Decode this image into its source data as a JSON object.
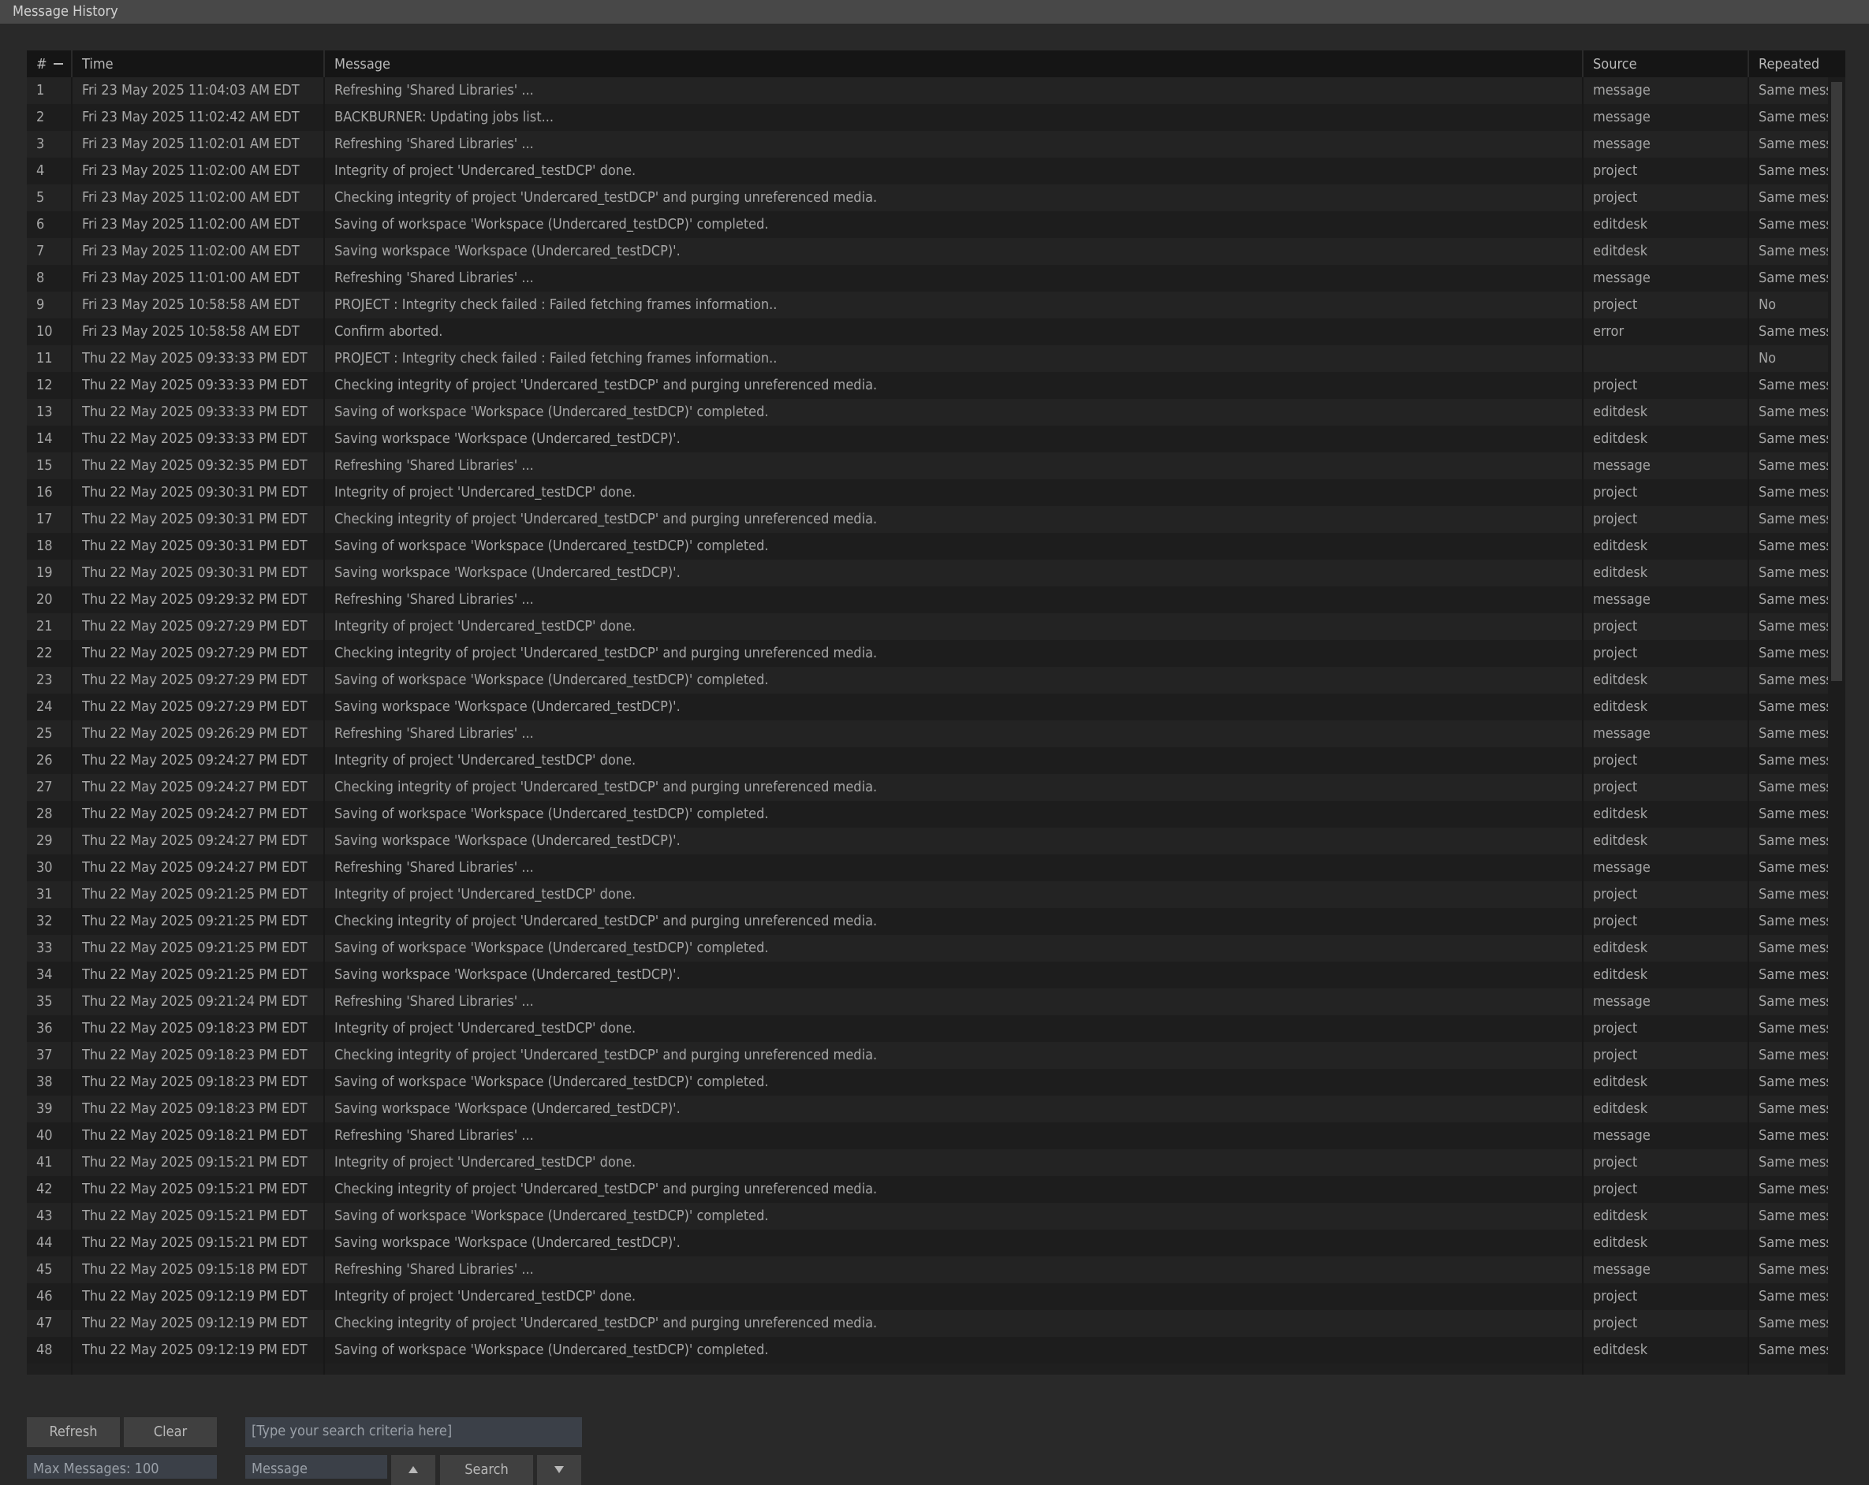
{
  "window": {
    "title": "Message History"
  },
  "table": {
    "columns": {
      "num": "#",
      "time": "Time",
      "message": "Message",
      "source": "Source",
      "repeated": "Repeated"
    },
    "rows": [
      {
        "num": "1",
        "time": "Fri 23 May 2025 11:04:03 AM EDT",
        "message": "Refreshing 'Shared Libraries' ...",
        "source": "message",
        "repeated": "Same mess"
      },
      {
        "num": "2",
        "time": "Fri 23 May 2025 11:02:42 AM EDT",
        "message": "BACKBURNER: Updating jobs list...",
        "source": "message",
        "repeated": "Same mess"
      },
      {
        "num": "3",
        "time": "Fri 23 May 2025 11:02:01 AM EDT",
        "message": "Refreshing 'Shared Libraries' ...",
        "source": "message",
        "repeated": "Same mess"
      },
      {
        "num": "4",
        "time": "Fri 23 May 2025 11:02:00 AM EDT",
        "message": "Integrity of project 'Undercared_testDCP' done.",
        "source": "project",
        "repeated": "Same mess"
      },
      {
        "num": "5",
        "time": "Fri 23 May 2025 11:02:00 AM EDT",
        "message": "Checking integrity of project 'Undercared_testDCP' and purging unreferenced media.",
        "source": "project",
        "repeated": "Same mess"
      },
      {
        "num": "6",
        "time": "Fri 23 May 2025 11:02:00 AM EDT",
        "message": "Saving of workspace 'Workspace (Undercared_testDCP)' completed.",
        "source": "editdesk",
        "repeated": "Same mess"
      },
      {
        "num": "7",
        "time": "Fri 23 May 2025 11:02:00 AM EDT",
        "message": "Saving workspace 'Workspace (Undercared_testDCP)'.",
        "source": "editdesk",
        "repeated": "Same mess"
      },
      {
        "num": "8",
        "time": "Fri 23 May 2025 11:01:00 AM EDT",
        "message": "Refreshing 'Shared Libraries' ...",
        "source": "message",
        "repeated": "Same mess"
      },
      {
        "num": "9",
        "time": "Fri 23 May 2025 10:58:58 AM EDT",
        "message": "PROJECT : Integrity check failed : Failed fetching frames information..",
        "source": "project",
        "repeated": "No"
      },
      {
        "num": "10",
        "time": "Fri 23 May 2025 10:58:58 AM EDT",
        "message": "Confirm aborted.",
        "source": "error",
        "repeated": "Same mess"
      },
      {
        "num": "11",
        "time": "Thu 22 May 2025 09:33:33 PM EDT",
        "message": "PROJECT : Integrity check failed : Failed fetching frames information..",
        "source": "",
        "repeated": "No"
      },
      {
        "num": "12",
        "time": "Thu 22 May 2025 09:33:33 PM EDT",
        "message": "Checking integrity of project 'Undercared_testDCP' and purging unreferenced media.",
        "source": "project",
        "repeated": "Same mess"
      },
      {
        "num": "13",
        "time": "Thu 22 May 2025 09:33:33 PM EDT",
        "message": "Saving of workspace 'Workspace (Undercared_testDCP)' completed.",
        "source": "editdesk",
        "repeated": "Same mess"
      },
      {
        "num": "14",
        "time": "Thu 22 May 2025 09:33:33 PM EDT",
        "message": "Saving workspace 'Workspace (Undercared_testDCP)'.",
        "source": "editdesk",
        "repeated": "Same mess"
      },
      {
        "num": "15",
        "time": "Thu 22 May 2025 09:32:35 PM EDT",
        "message": "Refreshing 'Shared Libraries' ...",
        "source": "message",
        "repeated": "Same mess"
      },
      {
        "num": "16",
        "time": "Thu 22 May 2025 09:30:31 PM EDT",
        "message": "Integrity of project 'Undercared_testDCP' done.",
        "source": "project",
        "repeated": "Same mess"
      },
      {
        "num": "17",
        "time": "Thu 22 May 2025 09:30:31 PM EDT",
        "message": "Checking integrity of project 'Undercared_testDCP' and purging unreferenced media.",
        "source": "project",
        "repeated": "Same mess"
      },
      {
        "num": "18",
        "time": "Thu 22 May 2025 09:30:31 PM EDT",
        "message": "Saving of workspace 'Workspace (Undercared_testDCP)' completed.",
        "source": "editdesk",
        "repeated": "Same mess"
      },
      {
        "num": "19",
        "time": "Thu 22 May 2025 09:30:31 PM EDT",
        "message": "Saving workspace 'Workspace (Undercared_testDCP)'.",
        "source": "editdesk",
        "repeated": "Same mess"
      },
      {
        "num": "20",
        "time": "Thu 22 May 2025 09:29:32 PM EDT",
        "message": "Refreshing 'Shared Libraries' ...",
        "source": "message",
        "repeated": "Same mess"
      },
      {
        "num": "21",
        "time": "Thu 22 May 2025 09:27:29 PM EDT",
        "message": "Integrity of project 'Undercared_testDCP' done.",
        "source": "project",
        "repeated": "Same mess"
      },
      {
        "num": "22",
        "time": "Thu 22 May 2025 09:27:29 PM EDT",
        "message": "Checking integrity of project 'Undercared_testDCP' and purging unreferenced media.",
        "source": "project",
        "repeated": "Same mess"
      },
      {
        "num": "23",
        "time": "Thu 22 May 2025 09:27:29 PM EDT",
        "message": "Saving of workspace 'Workspace (Undercared_testDCP)' completed.",
        "source": "editdesk",
        "repeated": "Same mess"
      },
      {
        "num": "24",
        "time": "Thu 22 May 2025 09:27:29 PM EDT",
        "message": "Saving workspace 'Workspace (Undercared_testDCP)'.",
        "source": "editdesk",
        "repeated": "Same mess"
      },
      {
        "num": "25",
        "time": "Thu 22 May 2025 09:26:29 PM EDT",
        "message": "Refreshing 'Shared Libraries' ...",
        "source": "message",
        "repeated": "Same mess"
      },
      {
        "num": "26",
        "time": "Thu 22 May 2025 09:24:27 PM EDT",
        "message": "Integrity of project 'Undercared_testDCP' done.",
        "source": "project",
        "repeated": "Same mess"
      },
      {
        "num": "27",
        "time": "Thu 22 May 2025 09:24:27 PM EDT",
        "message": "Checking integrity of project 'Undercared_testDCP' and purging unreferenced media.",
        "source": "project",
        "repeated": "Same mess"
      },
      {
        "num": "28",
        "time": "Thu 22 May 2025 09:24:27 PM EDT",
        "message": "Saving of workspace 'Workspace (Undercared_testDCP)' completed.",
        "source": "editdesk",
        "repeated": "Same mess"
      },
      {
        "num": "29",
        "time": "Thu 22 May 2025 09:24:27 PM EDT",
        "message": "Saving workspace 'Workspace (Undercared_testDCP)'.",
        "source": "editdesk",
        "repeated": "Same mess"
      },
      {
        "num": "30",
        "time": "Thu 22 May 2025 09:24:27 PM EDT",
        "message": "Refreshing 'Shared Libraries' ...",
        "source": "message",
        "repeated": "Same mess"
      },
      {
        "num": "31",
        "time": "Thu 22 May 2025 09:21:25 PM EDT",
        "message": "Integrity of project 'Undercared_testDCP' done.",
        "source": "project",
        "repeated": "Same mess"
      },
      {
        "num": "32",
        "time": "Thu 22 May 2025 09:21:25 PM EDT",
        "message": "Checking integrity of project 'Undercared_testDCP' and purging unreferenced media.",
        "source": "project",
        "repeated": "Same mess"
      },
      {
        "num": "33",
        "time": "Thu 22 May 2025 09:21:25 PM EDT",
        "message": "Saving of workspace 'Workspace (Undercared_testDCP)' completed.",
        "source": "editdesk",
        "repeated": "Same mess"
      },
      {
        "num": "34",
        "time": "Thu 22 May 2025 09:21:25 PM EDT",
        "message": "Saving workspace 'Workspace (Undercared_testDCP)'.",
        "source": "editdesk",
        "repeated": "Same mess"
      },
      {
        "num": "35",
        "time": "Thu 22 May 2025 09:21:24 PM EDT",
        "message": "Refreshing 'Shared Libraries' ...",
        "source": "message",
        "repeated": "Same mess"
      },
      {
        "num": "36",
        "time": "Thu 22 May 2025 09:18:23 PM EDT",
        "message": "Integrity of project 'Undercared_testDCP' done.",
        "source": "project",
        "repeated": "Same mess"
      },
      {
        "num": "37",
        "time": "Thu 22 May 2025 09:18:23 PM EDT",
        "message": "Checking integrity of project 'Undercared_testDCP' and purging unreferenced media.",
        "source": "project",
        "repeated": "Same mess"
      },
      {
        "num": "38",
        "time": "Thu 22 May 2025 09:18:23 PM EDT",
        "message": "Saving of workspace 'Workspace (Undercared_testDCP)' completed.",
        "source": "editdesk",
        "repeated": "Same mess"
      },
      {
        "num": "39",
        "time": "Thu 22 May 2025 09:18:23 PM EDT",
        "message": "Saving workspace 'Workspace (Undercared_testDCP)'.",
        "source": "editdesk",
        "repeated": "Same mess"
      },
      {
        "num": "40",
        "time": "Thu 22 May 2025 09:18:21 PM EDT",
        "message": "Refreshing 'Shared Libraries' ...",
        "source": "message",
        "repeated": "Same mess"
      },
      {
        "num": "41",
        "time": "Thu 22 May 2025 09:15:21 PM EDT",
        "message": "Integrity of project 'Undercared_testDCP' done.",
        "source": "project",
        "repeated": "Same mess"
      },
      {
        "num": "42",
        "time": "Thu 22 May 2025 09:15:21 PM EDT",
        "message": "Checking integrity of project 'Undercared_testDCP' and purging unreferenced media.",
        "source": "project",
        "repeated": "Same mess"
      },
      {
        "num": "43",
        "time": "Thu 22 May 2025 09:15:21 PM EDT",
        "message": "Saving of workspace 'Workspace (Undercared_testDCP)' completed.",
        "source": "editdesk",
        "repeated": "Same mess"
      },
      {
        "num": "44",
        "time": "Thu 22 May 2025 09:15:21 PM EDT",
        "message": "Saving workspace 'Workspace (Undercared_testDCP)'.",
        "source": "editdesk",
        "repeated": "Same mess"
      },
      {
        "num": "45",
        "time": "Thu 22 May 2025 09:15:18 PM EDT",
        "message": "Refreshing 'Shared Libraries' ...",
        "source": "message",
        "repeated": "Same mess"
      },
      {
        "num": "46",
        "time": "Thu 22 May 2025 09:12:19 PM EDT",
        "message": "Integrity of project 'Undercared_testDCP' done.",
        "source": "project",
        "repeated": "Same mess"
      },
      {
        "num": "47",
        "time": "Thu 22 May 2025 09:12:19 PM EDT",
        "message": "Checking integrity of project 'Undercared_testDCP' and purging unreferenced media.",
        "source": "project",
        "repeated": "Same mess"
      },
      {
        "num": "48",
        "time": "Thu 22 May 2025 09:12:19 PM EDT",
        "message": "Saving of workspace 'Workspace (Undercared_testDCP)' completed.",
        "source": "editdesk",
        "repeated": "Same mess"
      }
    ]
  },
  "controls": {
    "refresh_label": "Refresh",
    "clear_label": "Clear",
    "max_messages": "Max Messages: 100",
    "search_placeholder": "[Type your search criteria here]",
    "search_field_select": "Message",
    "search_label": "Search"
  },
  "icons": {
    "collapse": "collapse-icon",
    "up": "arrow-up-icon",
    "down": "arrow-down-icon"
  },
  "colors": {
    "background": "#292929",
    "title_bar": "#484848",
    "table_bg": "#1f1f1f",
    "header_bg": "#151515",
    "row_odd": "#232323",
    "row_even": "#1d1d1d",
    "text": "#a6a6a6",
    "input_bg": "#3b4048"
  }
}
